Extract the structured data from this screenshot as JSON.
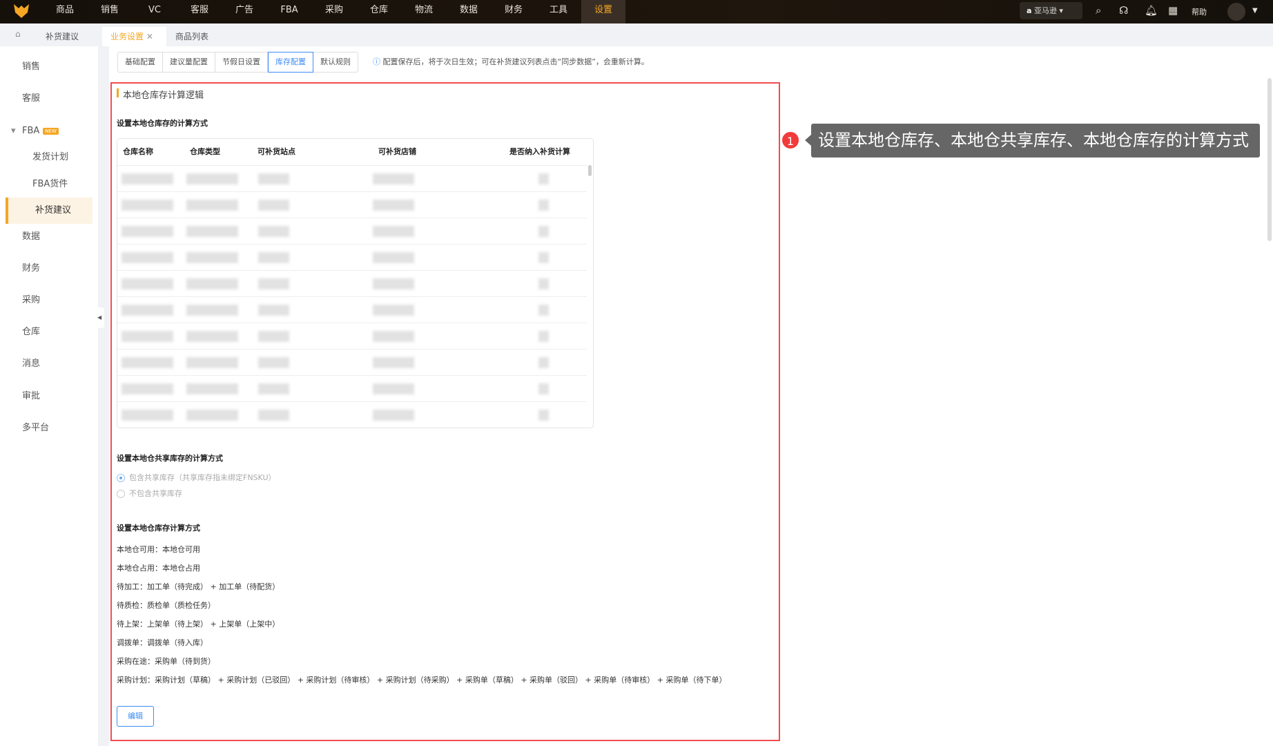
{
  "topnav": {
    "items": [
      "商品",
      "销售",
      "VC",
      "客服",
      "广告",
      "FBA",
      "采购",
      "仓库",
      "物流",
      "数据",
      "财务",
      "工具",
      "设置"
    ],
    "active": "设置",
    "account": "亚马逊",
    "help": "帮助"
  },
  "tabbar": {
    "breadcrumb": "补货建议",
    "tabs": [
      "业务设置",
      "商品列表"
    ]
  },
  "sidebar": {
    "items": [
      "销售",
      "客服",
      "FBA",
      "发货计划",
      "FBA货件",
      "补货建议",
      "数据",
      "财务",
      "采购",
      "仓库",
      "消息",
      "审批",
      "多平台"
    ],
    "badge": "NEW"
  },
  "subtabs": [
    "基础配置",
    "建议量配置",
    "节假日设置",
    "库存配置",
    "默认规则"
  ],
  "notice": "配置保存后，将于次日生效；可在补货建议列表点击“同步数据”，会重新计算。",
  "section_title": "本地仓库存计算逻辑",
  "sec1": {
    "title": "设置本地仓库存的计算方式",
    "columns": [
      "仓库名称",
      "仓库类型",
      "可补货站点",
      "可补货店铺",
      "是否纳入补货计算"
    ]
  },
  "sec2": {
    "title": "设置本地仓共享库存的计算方式",
    "options": [
      "包含共享库存（共享库存指未绑定FNSKU）",
      "不包含共享库存"
    ]
  },
  "sec3": {
    "title": "设置本地仓库存计算方式",
    "lines": [
      "本地仓可用：本地仓可用",
      "本地仓占用：本地仓占用",
      "待加工：加工单（待完成） + 加工单（待配货）",
      "待质检：质检单（质检任务）",
      "待上架：上架单（待上架） + 上架单（上架中）",
      "调拨单：调拨单（待入库）",
      "采购在途：采购单（待到货）",
      "采购计划：采购计划（草稿） + 采购计划（已驳回） + 采购计划（待审核） + 采购计划（待采购） + 采购单（草稿） + 采购单（驳回） + 采购单（待审核） + 采购单（待下单）"
    ]
  },
  "edit_button": "编辑",
  "annotation": {
    "number": "1",
    "text": "设置本地仓库存、本地仓共享库存、本地仓库存的计算方式"
  }
}
